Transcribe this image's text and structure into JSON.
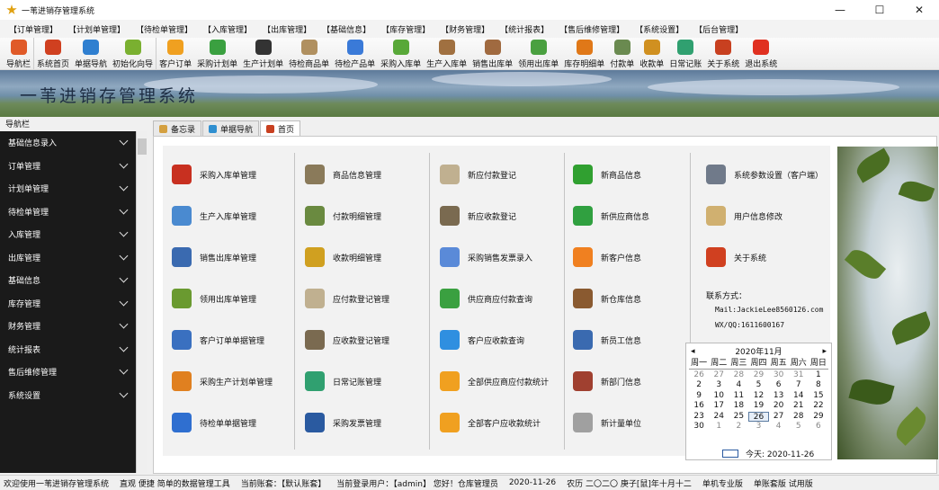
{
  "window": {
    "title": "一苇进销存管理系统",
    "min": "—",
    "max": "☐",
    "close": "✕"
  },
  "menu": [
    "【订单管理】",
    "【计划单管理】",
    "【待检单管理】",
    "【入库管理】",
    "【出库管理】",
    "【基础信息】",
    "【库存管理】",
    "【财务管理】",
    "【统计报表】",
    "【售后维修管理】",
    "【系统设置】",
    "【后台管理】"
  ],
  "toolbar": [
    {
      "label": "导航栏",
      "icon": "pie-chart-icon",
      "color": "#e05a28"
    },
    {
      "label": "系统首页",
      "icon": "home-icon",
      "color": "#d04020"
    },
    {
      "label": "单据导航",
      "icon": "compass-icon",
      "color": "#2f7fd0"
    },
    {
      "label": "初始化向导",
      "icon": "magic-wand-icon",
      "color": "#7ab030"
    },
    {
      "label": "客户订单",
      "icon": "coin-icon",
      "color": "#f0a020"
    },
    {
      "label": "采购计划单",
      "icon": "chat-icon",
      "color": "#3aa040"
    },
    {
      "label": "生产计划单",
      "icon": "chat-dark-icon",
      "color": "#333333"
    },
    {
      "label": "待检商品单",
      "icon": "checklist-icon",
      "color": "#b09060"
    },
    {
      "label": "待检产品单",
      "icon": "info-icon",
      "color": "#3a7ad8"
    },
    {
      "label": "采购入库单",
      "icon": "plus-circle-icon",
      "color": "#58a838"
    },
    {
      "label": "生产入库单",
      "icon": "stamp-icon",
      "color": "#a07040"
    },
    {
      "label": "销售出库单",
      "icon": "cabinet-icon",
      "color": "#a06a40"
    },
    {
      "label": "领用出库单",
      "icon": "arrow-icon",
      "color": "#4aa040"
    },
    {
      "label": "库存明细单",
      "icon": "warning-icon",
      "color": "#e07818"
    },
    {
      "label": "付款单",
      "icon": "money-icon",
      "color": "#6a8a50"
    },
    {
      "label": "收款单",
      "icon": "clock-icon",
      "color": "#d09020"
    },
    {
      "label": "日常记账",
      "icon": "notebook-icon",
      "color": "#30a070"
    },
    {
      "label": "关于系统",
      "icon": "house-icon",
      "color": "#c84020"
    },
    {
      "label": "退出系统",
      "icon": "power-icon",
      "color": "#e03020"
    }
  ],
  "banner": {
    "title": "一苇进销存管理系统"
  },
  "nav": {
    "header": "导航栏",
    "items": [
      "基础信息录入",
      "订单管理",
      "计划单管理",
      "待检单管理",
      "入库管理",
      "出库管理",
      "基础信息",
      "库存管理",
      "财务管理",
      "统计报表",
      "售后维修管理",
      "系统设置"
    ]
  },
  "tabs": [
    {
      "label": "备忘录",
      "color": "#d4a040"
    },
    {
      "label": "单据导航",
      "color": "#2f8fd0"
    },
    {
      "label": "首页",
      "color": "#c84020"
    }
  ],
  "columns": [
    [
      {
        "label": "采购入库单管理",
        "icon": "books-icon",
        "color": "#c83020"
      },
      {
        "label": "生产入库单管理",
        "icon": "stack-icon",
        "color": "#4a8ad0"
      },
      {
        "label": "销售出库单管理",
        "icon": "database-icon",
        "color": "#3a6ab0"
      },
      {
        "label": "领用出库单管理",
        "icon": "books-green-icon",
        "color": "#6a9a30"
      },
      {
        "label": "客户订单单据管理",
        "icon": "coins-icon",
        "color": "#3a70c0"
      },
      {
        "label": "采购生产计划单管理",
        "icon": "tools-icon",
        "color": "#e08020"
      },
      {
        "label": "待检单单据管理",
        "icon": "info-icon",
        "color": "#2f6fd0"
      }
    ],
    [
      {
        "label": "商品信息管理",
        "icon": "box-icon",
        "color": "#8a7a5a"
      },
      {
        "label": "付款明细管理",
        "icon": "money-icon",
        "color": "#6a8a40"
      },
      {
        "label": "收款明细管理",
        "icon": "clock-icon",
        "color": "#d0a020"
      },
      {
        "label": "应付款登记管理",
        "icon": "hand-icon",
        "color": "#c0b090"
      },
      {
        "label": "应收款登记管理",
        "icon": "address-book-icon",
        "color": "#7a6a50"
      },
      {
        "label": "日常记账管理",
        "icon": "checklist-icon",
        "color": "#30a070"
      },
      {
        "label": "采购发票管理",
        "icon": "book-icon",
        "color": "#2a5aa0"
      }
    ],
    [
      {
        "label": "新应付款登记",
        "icon": "hand-add-icon",
        "color": "#c0b090"
      },
      {
        "label": "新应收款登记",
        "icon": "address-book-icon",
        "color": "#7a6a50"
      },
      {
        "label": "采购销售发票录入",
        "icon": "card-icon",
        "color": "#5a8ad8"
      },
      {
        "label": "供应商应付款查询",
        "icon": "chat-icon",
        "color": "#3aa040"
      },
      {
        "label": "客户应收款查询",
        "icon": "chat-blue-icon",
        "color": "#2f8fe0"
      },
      {
        "label": "全部供应商应付款统计",
        "icon": "coin-icon",
        "color": "#f0a020"
      },
      {
        "label": "全部客户应收款统计",
        "icon": "coin-orange-icon",
        "color": "#f0a020"
      }
    ],
    [
      {
        "label": "新商品信息",
        "icon": "plus-icon",
        "color": "#30a030"
      },
      {
        "label": "新供应商信息",
        "icon": "phone-green-icon",
        "color": "#30a040"
      },
      {
        "label": "新客户信息",
        "icon": "phone-orange-icon",
        "color": "#f08020"
      },
      {
        "label": "新仓库信息",
        "icon": "house-icon",
        "color": "#8a5a30"
      },
      {
        "label": "新员工信息",
        "icon": "users-icon",
        "color": "#3a6ab0"
      },
      {
        "label": "新部门信息",
        "icon": "id-card-icon",
        "color": "#a04030"
      },
      {
        "label": "新计量单位",
        "icon": "document-icon",
        "color": "#a0a0a0"
      }
    ],
    [
      {
        "label": "系统参数设置（客户端）",
        "icon": "wrench-icon",
        "color": "#707a8a"
      },
      {
        "label": "用户信息修改",
        "icon": "note-icon",
        "color": "#d0b070"
      },
      {
        "label": "关于系统",
        "icon": "house-red-icon",
        "color": "#d04020"
      }
    ]
  ],
  "contact": {
    "title": "联系方式：",
    "mail": "Mail:JackieLee8560126.com",
    "wx": "WX/QQ:1611600167"
  },
  "calendar": {
    "prev": "◂",
    "next": "▸",
    "month": "2020年11月",
    "weekdays": [
      "周一",
      "周二",
      "周三",
      "周四",
      "周五",
      "周六",
      "周日"
    ],
    "days": [
      [
        "26",
        "27",
        "28",
        "29",
        "30",
        "31",
        "1"
      ],
      [
        "2",
        "3",
        "4",
        "5",
        "6",
        "7",
        "8"
      ],
      [
        "9",
        "10",
        "11",
        "12",
        "13",
        "14",
        "15"
      ],
      [
        "16",
        "17",
        "18",
        "19",
        "20",
        "21",
        "22"
      ],
      [
        "23",
        "24",
        "25",
        "26",
        "27",
        "28",
        "29"
      ],
      [
        "30",
        "1",
        "2",
        "3",
        "4",
        "5",
        "6"
      ]
    ],
    "selected": "26",
    "today_label": "今天: 2020-11-26"
  },
  "status": [
    "欢迎使用一苇进销存管理系统",
    "直观 便捷 简单的数据管理工具",
    "当前账套：【默认账套】",
    "当前登录用户：【admin】 您好！仓库管理员",
    "2020-11-26",
    "农历 二〇二〇 庚子[鼠]年十月十二",
    "单机专业版",
    "单账套版 试用版"
  ]
}
